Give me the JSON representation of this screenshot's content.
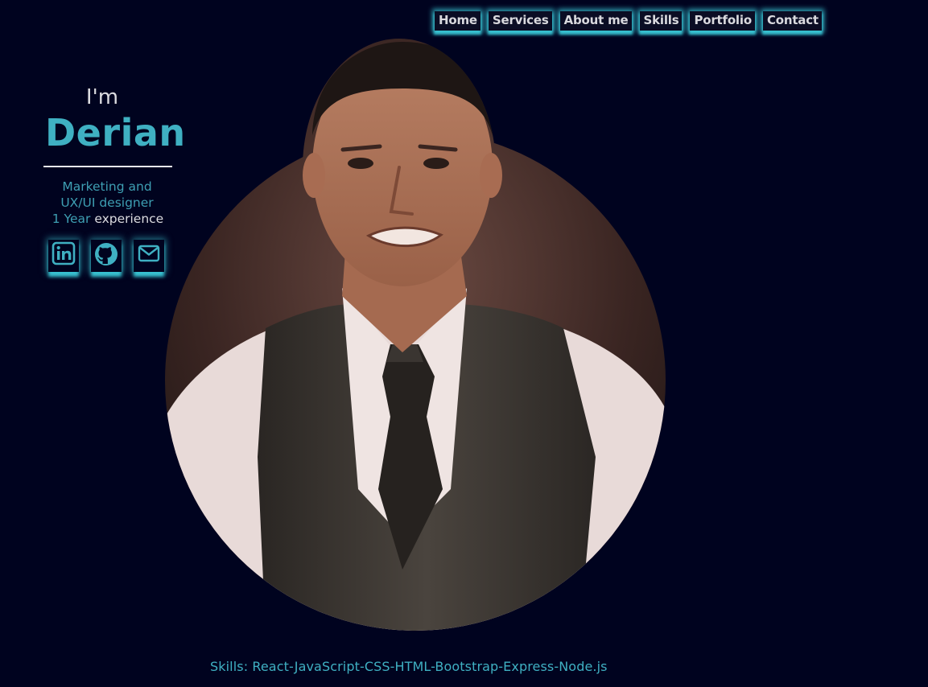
{
  "nav": {
    "items": [
      {
        "label": "Home"
      },
      {
        "label": "Services"
      },
      {
        "label": "About me"
      },
      {
        "label": "Skills"
      },
      {
        "label": "Portfolio"
      },
      {
        "label": "Contact"
      }
    ]
  },
  "intro": {
    "greeting": "I'm",
    "name": "Derian",
    "role_line1": "Marketing and",
    "role_line2": "UX/UI designer",
    "experience_value": "1 Year",
    "experience_label": "experience"
  },
  "social": [
    {
      "icon": "linkedin-icon"
    },
    {
      "icon": "github-icon"
    },
    {
      "icon": "mail-icon"
    }
  ],
  "skills": {
    "text": "Skills: React-JavaScript-CSS-HTML-Bootstrap-Express-Node.js"
  },
  "colors": {
    "background": "#00031f",
    "accent": "#3fb0c2",
    "glow": "#3ac8d7",
    "text": "#dcdce0"
  }
}
